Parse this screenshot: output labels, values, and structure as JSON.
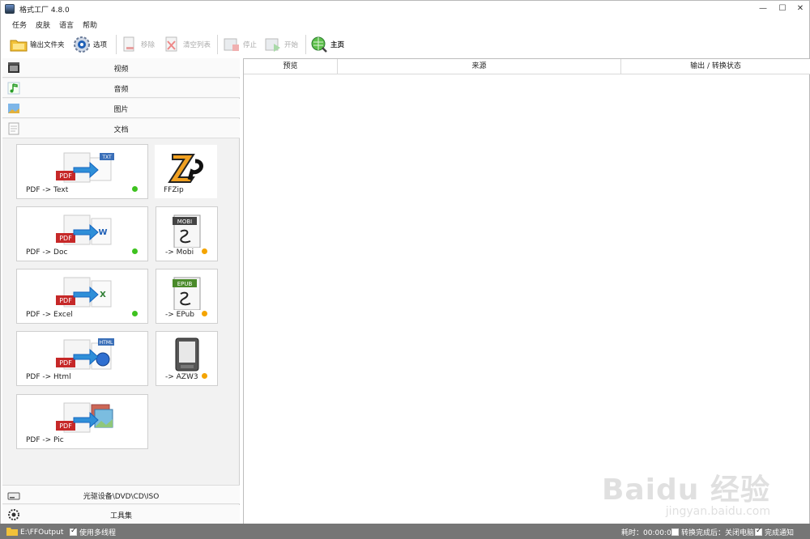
{
  "window": {
    "title": "格式工厂 4.8.0",
    "controls": [
      "—",
      "☐",
      "✕"
    ]
  },
  "menu": [
    "任务",
    "皮肤",
    "语言",
    "帮助"
  ],
  "toolbar": {
    "output_folder": "输出文件夹",
    "options": "选项",
    "remove": "移除",
    "clear_list": "清空列表",
    "stop": "停止",
    "start": "开始",
    "home": "主页"
  },
  "categories": {
    "video": "视频",
    "audio": "音频",
    "image": "图片",
    "document": "文档",
    "rom": "光驱设备\\DVD\\CD\\ISO",
    "tools": "工具集"
  },
  "tiles": [
    {
      "label": "PDF -> Text",
      "tag": "TXT",
      "status": "green"
    },
    {
      "label": "FFZip",
      "status": ""
    },
    {
      "label": "PDF -> Doc",
      "tag": "W",
      "status": "green"
    },
    {
      "label": "-> Mobi",
      "tag": "MOBI",
      "status": "orange"
    },
    {
      "label": "PDF -> Excel",
      "tag": "X",
      "status": "green"
    },
    {
      "label": "-> EPub",
      "tag": "EPUB",
      "status": "orange"
    },
    {
      "label": "PDF -> Html",
      "tag": "HTML",
      "status": ""
    },
    {
      "label": "-> AZW3",
      "status": "orange"
    },
    {
      "label": "PDF -> Pic",
      "status": ""
    }
  ],
  "pdf_tag": "PDF",
  "columns": {
    "preview": "预览",
    "source": "来源",
    "output": "输出 / 转换状态"
  },
  "status": {
    "output_path": "E:\\FFOutput",
    "multithread": "使用多线程",
    "elapsed": "耗时：00:00:00",
    "after_convert": "转换完成后：关闭电脑",
    "notify": "完成通知"
  },
  "watermark": {
    "brand": "Bai",
    "brand2": "du",
    "cn": "经验",
    "url": "jingyan.baidu.com"
  },
  "colors": {
    "green": "#3ec21f",
    "orange": "#f4a400",
    "statusbar": "#767676"
  }
}
